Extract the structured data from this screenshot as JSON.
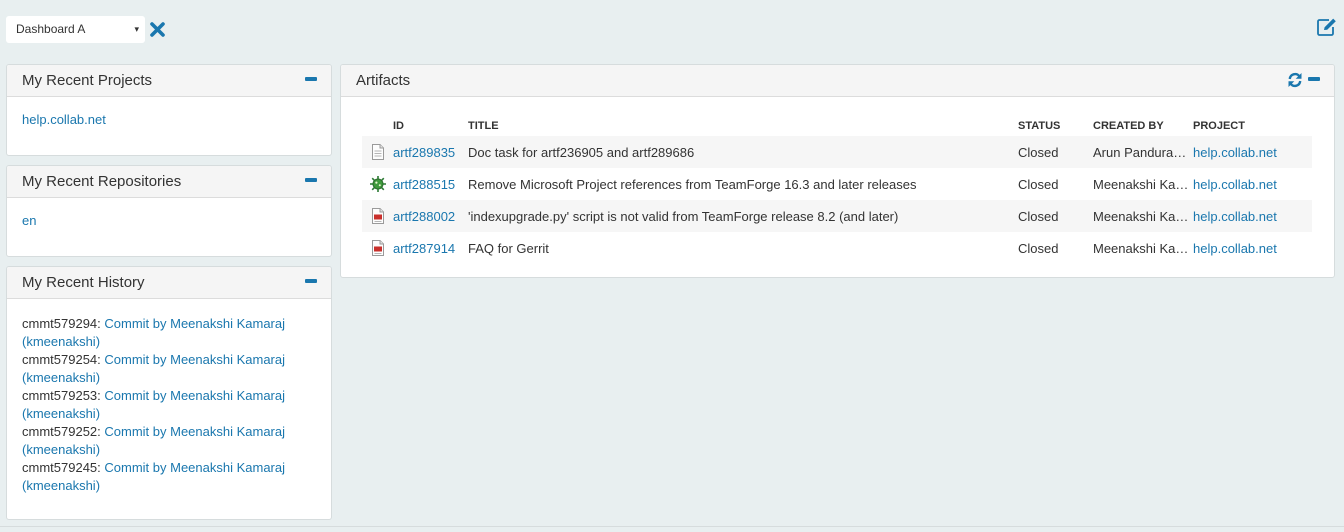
{
  "toolbar": {
    "dashboard_value": "Dashboard A",
    "caret": "▾",
    "close_icon": "close-x-icon",
    "edit_icon": "edit-icon"
  },
  "colors": {
    "accent": "#1a77ae",
    "background": "#e8eff0",
    "panel_header": "#f5f5f5"
  },
  "projects": {
    "title": "My Recent Projects",
    "items": [
      "help.collab.net"
    ]
  },
  "repositories": {
    "title": "My Recent Repositories",
    "items": [
      "en"
    ]
  },
  "history": {
    "title": "My Recent History",
    "items": [
      {
        "id": "cmmt579294:",
        "link": "Commit by Meenakshi Kamaraj",
        "user": "(kmeenakshi)"
      },
      {
        "id": "cmmt579254:",
        "link": "Commit by Meenakshi Kamaraj",
        "user": "(kmeenakshi)"
      },
      {
        "id": "cmmt579253:",
        "link": "Commit by Meenakshi Kamaraj",
        "user": "(kmeenakshi)"
      },
      {
        "id": "cmmt579252:",
        "link": "Commit by Meenakshi Kamaraj",
        "user": "(kmeenakshi)"
      },
      {
        "id": "cmmt579245:",
        "link": "Commit by Meenakshi Kamaraj",
        "user": "(kmeenakshi)"
      }
    ]
  },
  "artifacts": {
    "title": "Artifacts",
    "columns": {
      "id": "ID",
      "title": "TITLE",
      "status": "STATUS",
      "created_by": "CREATED BY",
      "project": "PROJECT"
    },
    "rows": [
      {
        "icon": "document-icon",
        "id": "artf289835",
        "title": "Doc task for artf236905 and artf289686",
        "status": "Closed",
        "created_by": "Arun Pandurangan",
        "project": "help.collab.net"
      },
      {
        "icon": "defect-bug-icon",
        "id": "artf288515",
        "title": "Remove Microsoft Project references from TeamForge 16.3 and later releases",
        "status": "Closed",
        "created_by": "Meenakshi Kamaraj",
        "project": "help.collab.net"
      },
      {
        "icon": "pdf-document-icon",
        "id": "artf288002",
        "title": "'indexupgrade.py' script is not valid from TeamForge release 8.2 (and later)",
        "status": "Closed",
        "created_by": "Meenakshi Kamaraj",
        "project": "help.collab.net"
      },
      {
        "icon": "pdf-document-icon",
        "id": "artf287914",
        "title": "FAQ for Gerrit",
        "status": "Closed",
        "created_by": "Meenakshi Kamaraj",
        "project": "help.collab.net"
      }
    ]
  }
}
